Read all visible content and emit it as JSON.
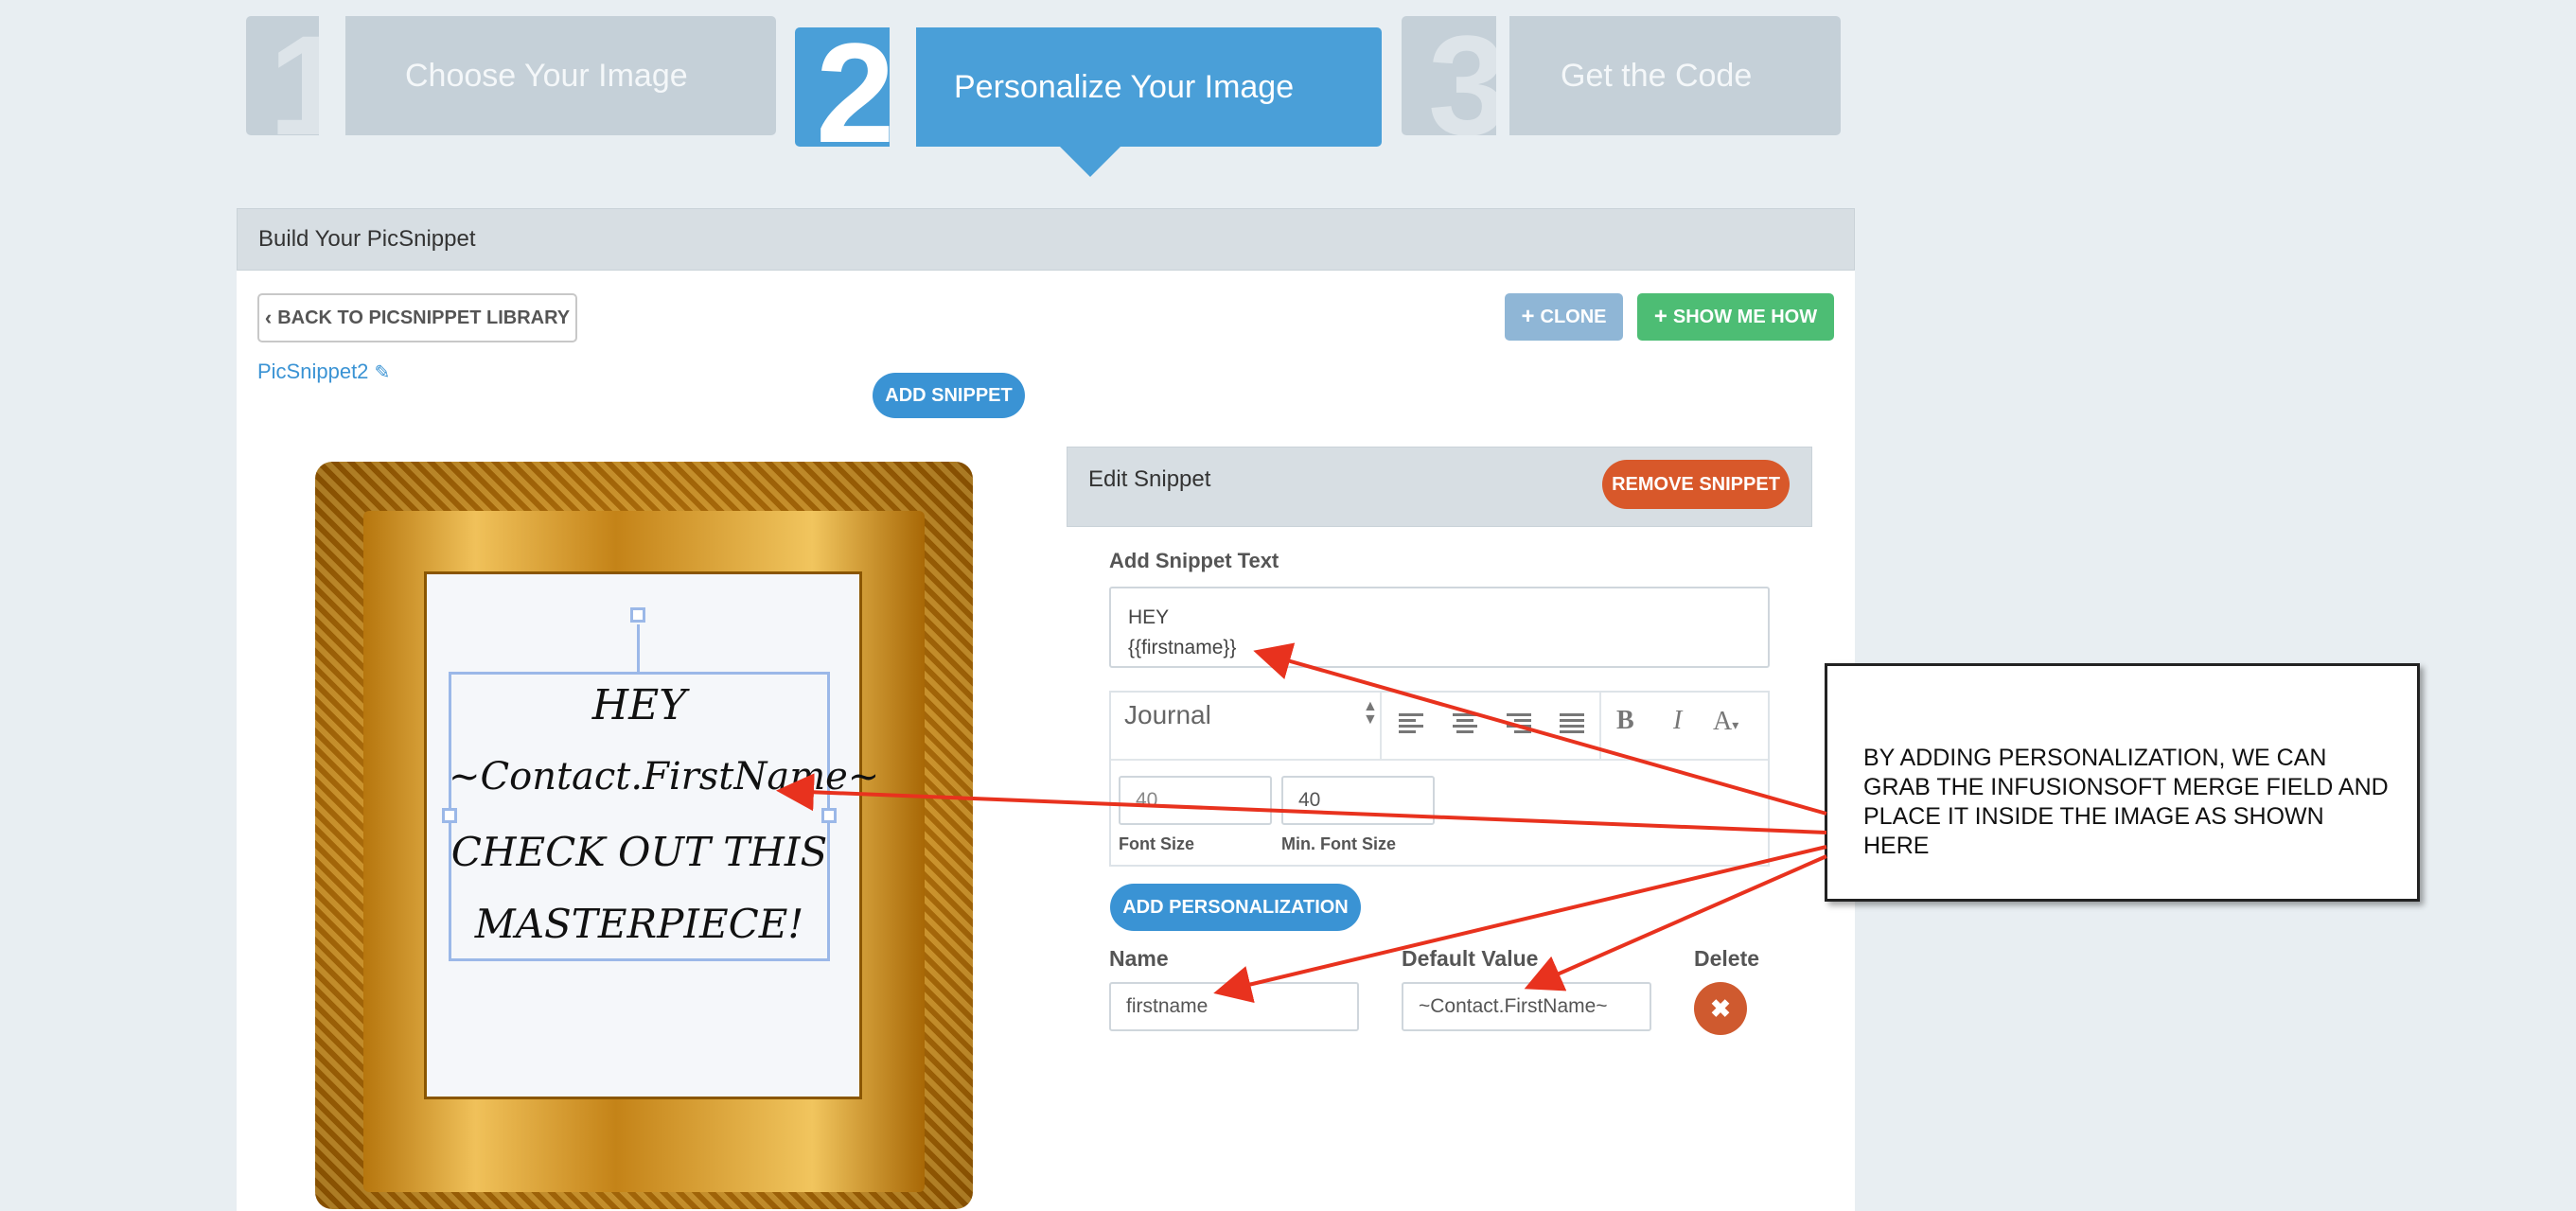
{
  "steps": [
    {
      "number": "1",
      "label": "Choose Your Image"
    },
    {
      "number": "2",
      "label": "Personalize Your Image"
    },
    {
      "number": "3",
      "label": "Get the Code"
    }
  ],
  "panel": {
    "title": "Build Your PicSnippet"
  },
  "toolbar": {
    "back_label": "BACK TO PICSNIPPET LIBRARY",
    "clone_label": "CLONE",
    "show_me_how_label": "SHOW ME HOW"
  },
  "snippet_name": "PicSnippet2",
  "add_snippet_label": "ADD SNIPPET",
  "canvas": {
    "lines": [
      "HEY",
      "~Contact.FirstName~",
      "CHECK OUT THIS",
      "MASTERPIECE!"
    ]
  },
  "edit": {
    "title": "Edit Snippet",
    "remove_label": "REMOVE SNIPPET",
    "text_label": "Add Snippet Text",
    "text_line1": "HEY",
    "text_line2": "{{firstname}}",
    "font": "Journal",
    "font_size_value": "40",
    "min_font_size_value": "40",
    "font_size_label": "Font Size",
    "min_font_size_label": "Min. Font Size",
    "bold_glyph": "B",
    "italic_glyph": "I",
    "color_glyph": "A",
    "add_personalization_label": "ADD PERSONALIZATION",
    "name_header": "Name",
    "default_header": "Default Value",
    "delete_header": "Delete",
    "name_value": "firstname",
    "default_value": "~Contact.FirstName~"
  },
  "callout": {
    "text": "BY ADDING PERSONALIZATION, WE CAN GRAB THE INFUSIONSOFT MERGE FIELD AND PLACE IT INSIDE THE IMAGE AS SHOWN HERE"
  },
  "colors": {
    "accent_blue": "#4a9fd8",
    "green": "#4dbd74",
    "orange": "#d8582a",
    "annotation_red": "#e8321e"
  }
}
